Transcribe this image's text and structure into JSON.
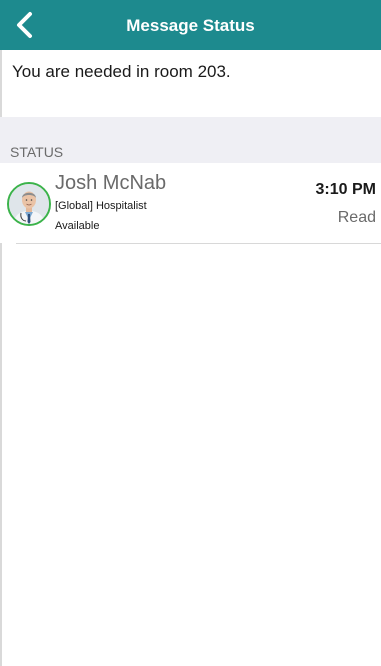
{
  "nav": {
    "title": "Message Status",
    "back_icon": "chevron-left-icon",
    "bar_color": "#1d8a8e"
  },
  "message": {
    "text": "You are needed in room 203."
  },
  "status_section": {
    "header": "STATUS",
    "items": [
      {
        "name": "Josh McNab",
        "role": "[Global] Hospitalist",
        "availability": "Available",
        "availability_color": "#3bb34a",
        "time": "3:10 PM",
        "read_status": "Read"
      }
    ]
  }
}
